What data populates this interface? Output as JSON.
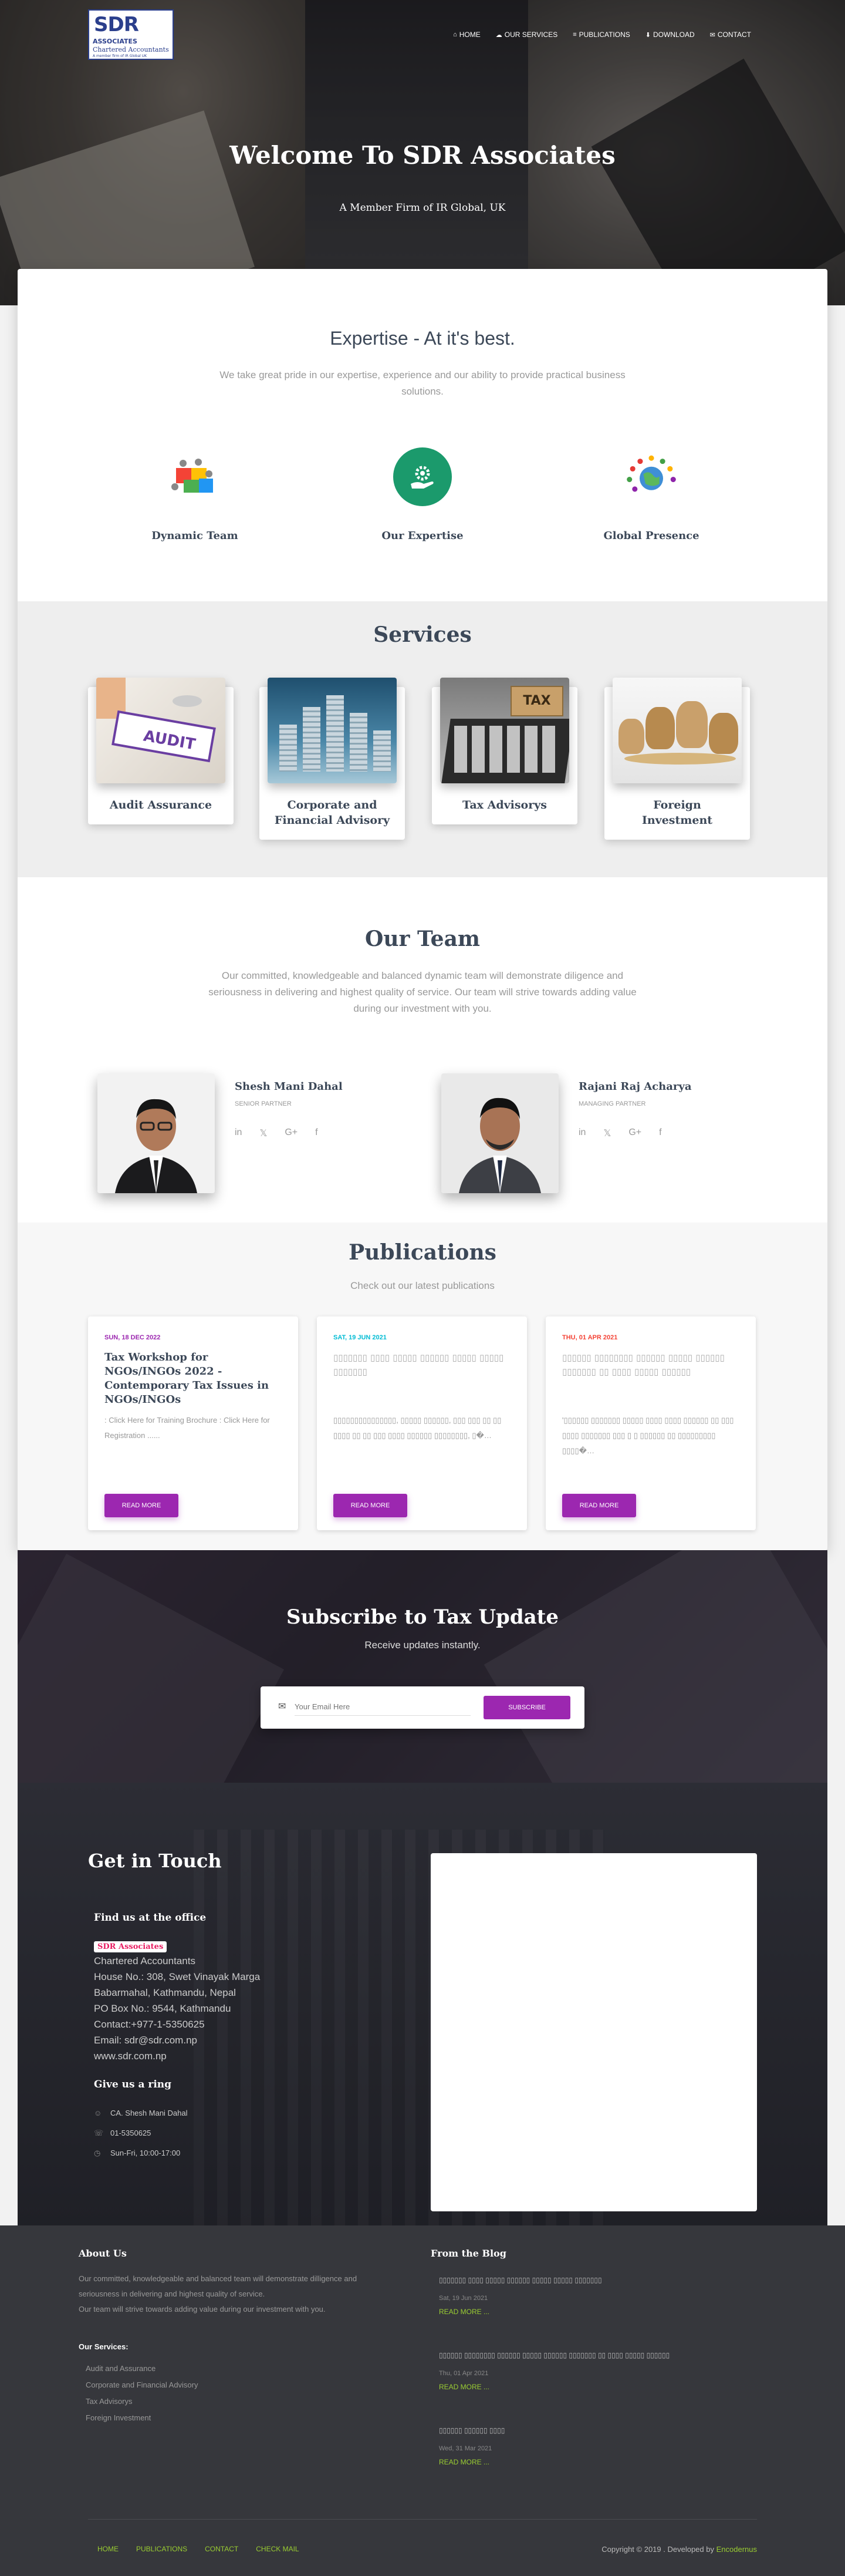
{
  "header": {
    "logo": {
      "l1": "SDR",
      "l2": "ASSOCIATES",
      "l3": "Chartered Accountants",
      "l4": "A member firm of IR Global UK"
    },
    "nav": [
      {
        "label": "Home",
        "icon": "home-icon",
        "glyph": "⌂"
      },
      {
        "label": "Our Services",
        "icon": "cloud-icon",
        "glyph": "☁"
      },
      {
        "label": "Publications",
        "icon": "list-icon",
        "glyph": "≡"
      },
      {
        "label": "Download",
        "icon": "download-icon",
        "glyph": "⬇"
      },
      {
        "label": "Contact",
        "icon": "mail-icon",
        "glyph": "✉"
      }
    ],
    "title": "Welcome To SDR Associates",
    "tagline": "A Member Firm of IR Global, UK"
  },
  "expertise": {
    "title": "Expertise - At it's best.",
    "description": "We take great pride in our expertise, experience and our ability to provide practical business solutions.",
    "features": [
      {
        "label": "Dynamic Team",
        "icon": "puzzle-team-icon",
        "glyph": "✦"
      },
      {
        "label": "Our Expertise",
        "icon": "gear-hand-icon",
        "glyph": "⚙"
      },
      {
        "label": "Global Presence",
        "icon": "globe-people-icon",
        "glyph": "◉"
      }
    ]
  },
  "services": {
    "title": "Services",
    "items": [
      {
        "name": "Audit Assurance"
      },
      {
        "name": "Corporate and Financial Advisory"
      },
      {
        "name": "Tax Advisorys"
      },
      {
        "name": "Foreign Investment"
      }
    ]
  },
  "team": {
    "title": "Our Team",
    "description": "Our committed, knowledgeable and balanced dynamic team will demonstrate diligence and seriousness in delivering and highest quality of service. Our team will strive towards adding value during our investment with you.",
    "members": [
      {
        "name": "Shesh Mani Dahal",
        "role": "Senior Partner"
      },
      {
        "name": "Rajani Raj Acharya",
        "role": "Managing Partner"
      }
    ],
    "socials": [
      "in",
      "𝕏",
      "G+",
      "f"
    ]
  },
  "publications": {
    "title": "Publications",
    "subtitle": "Check out our latest publications",
    "items": [
      {
        "date": "SUN, 18 DEC 2022",
        "date_color": "#9c27b0",
        "title": "Tax Workshop for NGOs/INGOs 2022 - Contemporary Tax Issues in NGOs/INGOs",
        "excerpt": ": Click Here for Training Brochure : Click Here for Registration ......",
        "button": "Read More"
      },
      {
        "date": "SAT, 19 JUN 2021",
        "date_color": "#00bcd4",
        "title": "▯▯▯▯▯▯▯ ▯▯▯▯ ▯▯▯▯▯ ▯▯▯▯▯▯ ▯▯▯▯▯ ▯▯▯▯▯ ▯▯▯▯▯▯▯",
        "excerpt": "▯▯▯▯▯▯▯▯▯▯▯▯▯▯▯, ▯▯▯▯▯ ▯▯▯▯▯▯, ▯▯▯ ▯▯▯ ▯▯ ▯▯ ▯▯▯▯ ▯▯ ▯▯ ▯▯▯ ▯▯▯▯ ▯▯▯▯▯▯ ▯▯▯▯▯▯▯▯, ▯�…",
        "button": "Read More"
      },
      {
        "date": "THU, 01 APR 2021",
        "date_color": "#f44336",
        "title": "▯▯▯▯▯▯ ▯▯▯▯▯▯▯▯ ▯▯▯▯▯▯ ▯▯▯▯▯ ▯▯▯▯▯▯ ▯▯▯▯▯▯▯ ▯▯ ▯▯▯▯ ▯▯▯▯▯ ▯▯▯▯▯▯",
        "excerpt": "'▯▯▯▯▯▯ ▯▯▯▯▯▯▯ ▯▯▯▯▯ ▯▯▯▯ ▯▯▯▯ ▯▯▯▯▯▯ ▯▯ ▯▯▯ ▯▯▯▯ ▯▯▯▯▯▯▯ ▯▯▯ ▯ ▯ ▯▯▯▯▯▯ ▯▯ ▯▯▯▯▯▯▯▯▯ ▯▯▯▯�…",
        "button": "Read More"
      }
    ]
  },
  "subscribe": {
    "title": "Subscribe to Tax Update",
    "subtitle": "Receive updates instantly.",
    "placeholder": "Your Email Here",
    "button": "Subscribe"
  },
  "contact": {
    "title": "Get in Touch",
    "office_heading": "Find us at the office",
    "name": "SDR Associates",
    "address": [
      "Chartered Accountants",
      "House No.: 308, Swet Vinayak Marga",
      "Babarmahal, Kathmandu, Nepal",
      "PO Box No.: 9544, Kathmandu",
      "Contact:+977-1-5350625",
      "Email: sdr@sdr.com.np",
      "www.sdr.com.np"
    ],
    "ring_heading": "Give us a ring",
    "ring": [
      {
        "icon": "user-icon",
        "glyph": "☺",
        "text": "CA. Shesh Mani Dahal"
      },
      {
        "icon": "phone-icon",
        "glyph": "☏",
        "text": "01-5350625"
      },
      {
        "icon": "clock-icon",
        "glyph": "◷",
        "text": "Sun-Fri, 10:00-17:00"
      }
    ]
  },
  "footer": {
    "about_heading": "About Us",
    "about_text_1": "Our committed, knowledgeable and balanced team will demonstrate dilligence and seriousness in delivering and highest quality of service.",
    "about_text_2": "Our team will strive towards adding value during our investment with you.",
    "services_heading": "Our Services:",
    "services": [
      "Audit and Assurance",
      "Corporate and Financial Advisory",
      "Tax Advisorys",
      "Foreign Investment"
    ],
    "blog_heading": "From the Blog",
    "blog": [
      {
        "title": "▯▯▯▯▯▯▯ ▯▯▯▯ ▯▯▯▯▯ ▯▯▯▯▯▯ ▯▯▯▯▯ ▯▯▯▯▯ ▯▯▯▯▯▯▯",
        "date": "Sat, 19 Jun 2021",
        "more": "READ MORE ..."
      },
      {
        "title": "▯▯▯▯▯▯ ▯▯▯▯▯▯▯▯ ▯▯▯▯▯▯ ▯▯▯▯▯ ▯▯▯▯▯▯ ▯▯▯▯▯▯▯ ▯▯ ▯▯▯▯ ▯▯▯▯▯ ▯▯▯▯▯▯",
        "date": "Thu, 01 Apr 2021",
        "more": "READ MORE ..."
      },
      {
        "title": "▯▯▯▯▯▯ ▯▯▯▯▯▯ ▯▯▯▯",
        "date": "Wed, 31 Mar 2021",
        "more": "READ MORE ..."
      }
    ],
    "links": [
      "Home",
      "Publications",
      "Contact",
      "Check Mail"
    ],
    "copyright": "Copyright © 2019 . Developed by",
    "developer": "Encodernus"
  }
}
